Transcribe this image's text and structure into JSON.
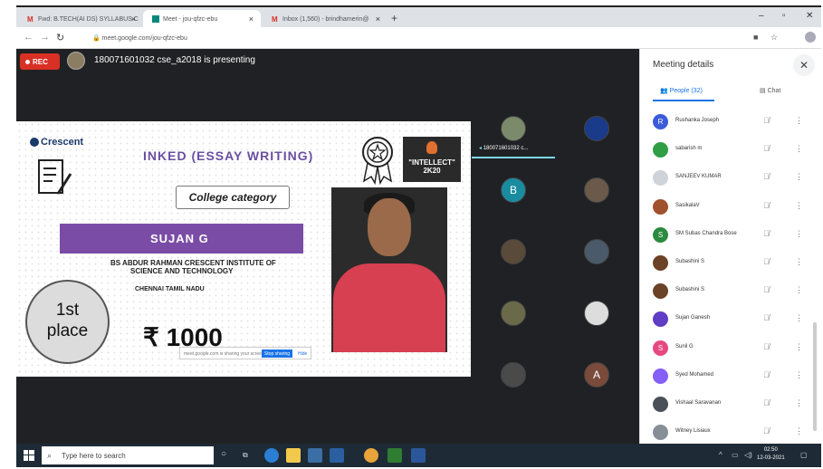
{
  "browser": {
    "tabs": [
      {
        "label": "Fwd: B.TECH(AI DS) SYLLABUS C"
      },
      {
        "label": "Meet - jou-qfzc-ebu"
      },
      {
        "label": "Inbox (1,560) - brindhamerin@"
      }
    ],
    "url": "meet.google.com/jou-qfzc-ebu"
  },
  "meet": {
    "rec_label": "REC",
    "presenting_text": "180071601032 cse_a2018 is presenting",
    "tile_name": "180071601032 c...",
    "tiles": [
      {
        "initial": ""
      },
      {
        "initial": ""
      },
      {
        "initial": "B"
      },
      {
        "initial": ""
      },
      {
        "initial": ""
      },
      {
        "initial": ""
      },
      {
        "initial": ""
      },
      {
        "initial": ""
      },
      {
        "initial": ""
      },
      {
        "initial": "A"
      }
    ]
  },
  "slide": {
    "logo": "Crescent",
    "title": "INKED (ESSAY WRITING)",
    "intellect_line1": "\"INTELLECT\"",
    "intellect_line2": "2K20",
    "category": "College category",
    "name": "SUJAN G",
    "institution_line1": "BS ABDUR RAHMAN CRESCENT INSTITUTE OF",
    "institution_line2": "SCIENCE AND TECHNOLOGY",
    "city": "CHENNAI TAMIL NADU",
    "place_line1": "1st",
    "place_line2": "place",
    "prize": "₹ 1000",
    "share_bar_text": "meet.google.com is sharing your screen.",
    "share_bar_button": "Stop sharing",
    "share_bar_hide": "Hide"
  },
  "panel": {
    "title": "Meeting details",
    "people_tab": "People (32)",
    "chat_tab": "Chat",
    "participants": [
      {
        "name": "Rushanka Joseph",
        "initial": "R",
        "color": "#3b5bdb"
      },
      {
        "name": "sabarish m",
        "initial": "",
        "color": "#2f9e44"
      },
      {
        "name": "SANJEEV KUMAR",
        "initial": "",
        "color": "#ced4da"
      },
      {
        "name": "SasikalaV",
        "initial": "",
        "color": "#a0522d"
      },
      {
        "name": "SM Subas Chandra Bose",
        "initial": "S",
        "color": "#2b8a3e"
      },
      {
        "name": "Subashini S",
        "initial": "",
        "color": "#6b4226"
      },
      {
        "name": "Subashini S",
        "initial": "",
        "color": "#6b4226"
      },
      {
        "name": "Sujan Ganesh",
        "initial": "",
        "color": "#5f3dc4"
      },
      {
        "name": "Sunil G",
        "initial": "S",
        "color": "#e64980"
      },
      {
        "name": "Syed Mohamed",
        "initial": "",
        "color": "#845ef7"
      },
      {
        "name": "Vishaal Saravanan",
        "initial": "",
        "color": "#495057"
      },
      {
        "name": "Witney Lisiaux",
        "initial": "",
        "color": "#868e96"
      }
    ]
  },
  "taskbar": {
    "search_placeholder": "Type here to search",
    "time": "02:50",
    "date": "12-03-2021"
  }
}
